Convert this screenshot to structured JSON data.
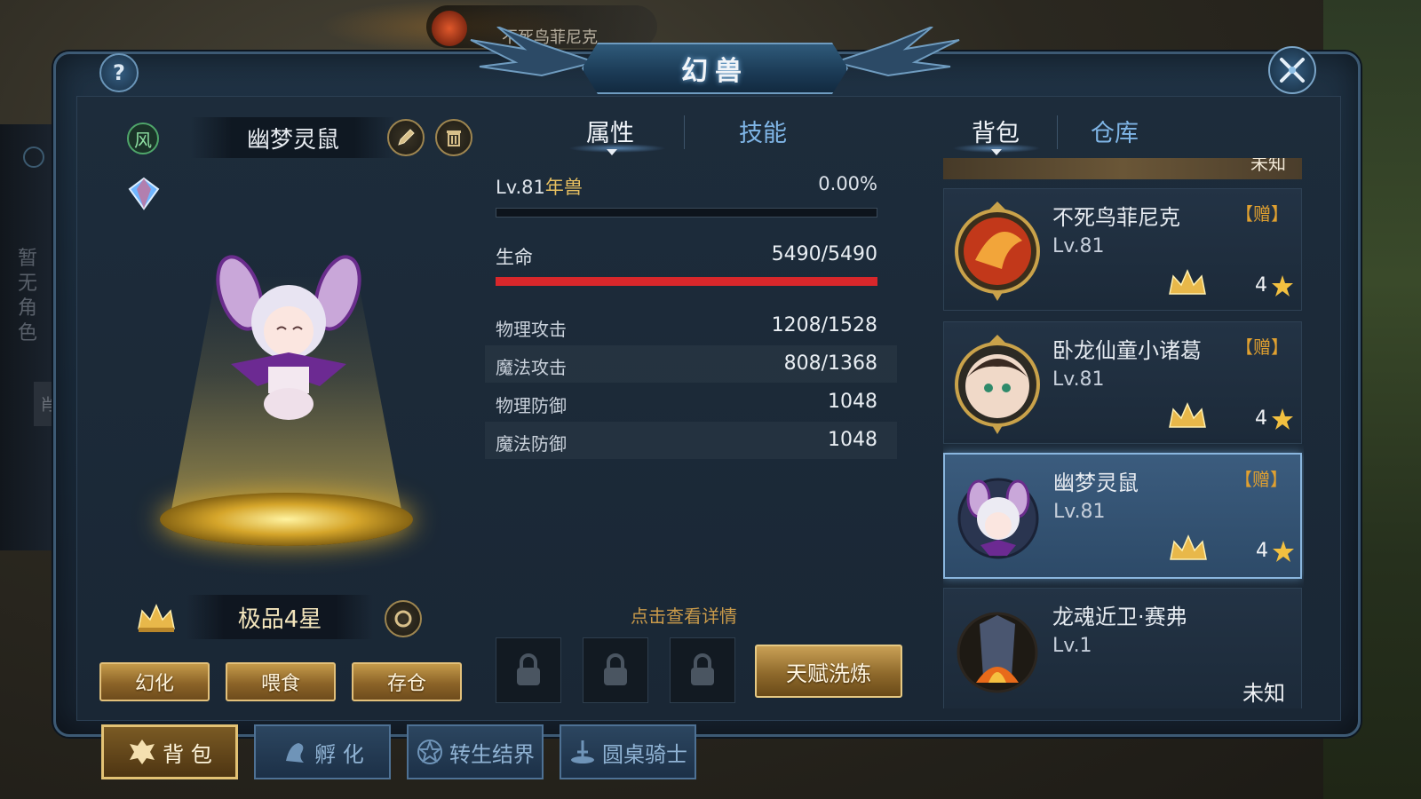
{
  "background": {
    "top_banner_text": "不死鸟菲尼克",
    "left_text": "暂无角色",
    "left_tab": "肖"
  },
  "window": {
    "title": "幻兽",
    "help_label": "?"
  },
  "pet": {
    "element_label": "风",
    "name": "幽梦灵鼠",
    "rank_text": "极品4星",
    "actions": [
      "幻化",
      "喂食",
      "存仓"
    ]
  },
  "tabs": {
    "attributes": "属性",
    "skills": "技能",
    "bag": "背包",
    "warehouse": "仓库"
  },
  "stats": {
    "level_text": "Lv.81",
    "beast_type": "年兽",
    "exp_percent": "0.00%",
    "exp_fraction": 0.0,
    "hp_label": "生命",
    "hp_value": "5490/5490",
    "hp_fraction": 1.0,
    "rows": [
      {
        "label": "物理攻击",
        "value": "1208/1528"
      },
      {
        "label": "魔法攻击",
        "value": "808/1368"
      },
      {
        "label": "物理防御",
        "value": "1048"
      },
      {
        "label": "魔法防御",
        "value": "1048"
      }
    ],
    "detail_link": "点击查看详情",
    "talent_button": "天赋洗炼"
  },
  "pet_list": {
    "top_partial_text": "未知",
    "items": [
      {
        "name": "不死鸟菲尼克",
        "level": "Lv.81",
        "gift": "【赠】",
        "stars": "4",
        "unknown": ""
      },
      {
        "name": "卧龙仙童小诸葛",
        "level": "Lv.81",
        "gift": "【赠】",
        "stars": "4",
        "unknown": ""
      },
      {
        "name": "幽梦灵鼠",
        "level": "Lv.81",
        "gift": "【赠】",
        "stars": "4",
        "unknown": ""
      },
      {
        "name": "龙魂近卫·赛弗",
        "level": "Lv.1",
        "gift": "",
        "stars": "",
        "unknown": "未知"
      }
    ]
  },
  "bottom_nav": [
    "背 包",
    "孵 化",
    "转生结界",
    "圆桌骑士"
  ],
  "colors": {
    "hp_bar": "#d8272b",
    "gold": "#e2c07a",
    "gift": "#e0a030",
    "beast_type": "#e8c060"
  }
}
